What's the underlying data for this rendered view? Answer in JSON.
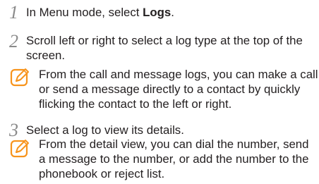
{
  "step1": {
    "number": "1",
    "text_prefix": "In Menu mode, select ",
    "text_bold": "Logs",
    "text_suffix": "."
  },
  "step2": {
    "number": "2",
    "line1": "Scroll left or right to select a log type at the top of the",
    "line2": "screen."
  },
  "note1": {
    "icon": "note-pencil-icon",
    "line1": "From the call and message logs, you can make a call",
    "line2": "or send a message directly to a contact by quickly",
    "line3": "flicking the contact to the left or right."
  },
  "step3": {
    "number": "3",
    "text": "Select a log to view its details."
  },
  "note2": {
    "icon": "note-pencil-icon",
    "line1": "From the detail view, you can dial the number, send",
    "line2": "a message to the number, or add the number to the",
    "line3": "phonebook or reject list."
  },
  "colors": {
    "text": "#231f20",
    "step_number": "#8a8a8a",
    "note_icon": "#f7941d"
  }
}
